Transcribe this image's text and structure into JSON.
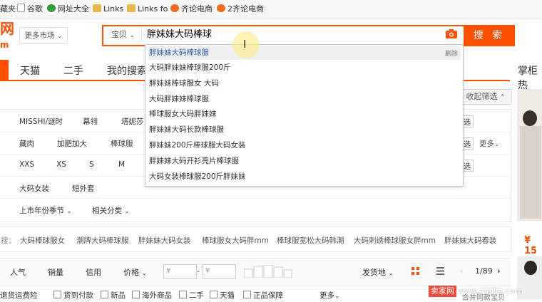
{
  "bookmarks": [
    {
      "label": "藏夹",
      "icon": "none"
    },
    {
      "label": "谷歌",
      "icon": "document-icon"
    },
    {
      "label": "网址大全",
      "icon": "green-circle-icon"
    },
    {
      "label": "Links",
      "icon": "folder-icon"
    },
    {
      "label": "Links fo",
      "icon": "folder-icon"
    },
    {
      "label": "齐论电商",
      "icon": "orange-circle-icon"
    },
    {
      "label": "2齐论电商",
      "icon": "orange-circle-icon"
    }
  ],
  "header": {
    "logo_text": "网",
    "logo_sub": "m",
    "market_label": "更多市场",
    "search_scope": "宝贝",
    "search_query": "胖妹妹大码棒球",
    "search_button": "搜 索"
  },
  "nav": {
    "tabs": [
      "天猫",
      "二手",
      "我的搜索"
    ],
    "right_title": "掌柜热"
  },
  "suggestions": [
    "胖妹妹大码棒球服",
    "大码胖妹妹棒球服200斤",
    "胖妹妹棒球服女 大码",
    "大码胖妹妹棒球服",
    "棒球服女大码胖妹妹",
    "胖妹妹大码长款棒球服",
    "胖妹妹200斤棒球服大码女装",
    "胖妹妹大码开衫亮片棒球服",
    "大码女装棒球服200斤胖妹妹"
  ],
  "suggestion_delete": "删除",
  "filters": {
    "collapse_label": "收起筛选",
    "row1": [
      "MISSHI/谜时",
      "幕翎",
      "塔妮莎"
    ],
    "row2": [
      "藏肉",
      "加肥加大",
      "棒球服"
    ],
    "row3": [
      "XXS",
      "XS",
      "S",
      "M"
    ],
    "row4": [
      "大码女装",
      "短外套"
    ],
    "row5": [
      "上市年份季节",
      "相关分类"
    ],
    "select_label": "选",
    "more_label": "更多"
  },
  "related": {
    "label": "搜：",
    "items": [
      "大码棒球服女",
      "潮牌大码棒球服",
      "胖妹妹大码女装",
      "棒球服女大码胖mm",
      "棒球服宽松大码韩潮",
      "大码刺绣棒球服女胖mm",
      "胖妹妹大码春装"
    ]
  },
  "sort": {
    "items": [
      "人气",
      "销量",
      "信用",
      "价格"
    ],
    "price_from": "¥",
    "price_to": "¥",
    "price_sep": "-",
    "ship_from": "发货地",
    "page": "1/89"
  },
  "options": [
    "退货运费险",
    "货到付款",
    "新品",
    "海外商品",
    "二手",
    "天猫",
    "正品保障"
  ],
  "options_more": "更多",
  "options_tail": "合并同款宝贝",
  "side_price": "¥ 15",
  "watermark": {
    "brand": "卖家网",
    "url": "www.maijia.com"
  },
  "colors": {
    "accent": "#ff5000",
    "link": "#2c5fb0"
  }
}
